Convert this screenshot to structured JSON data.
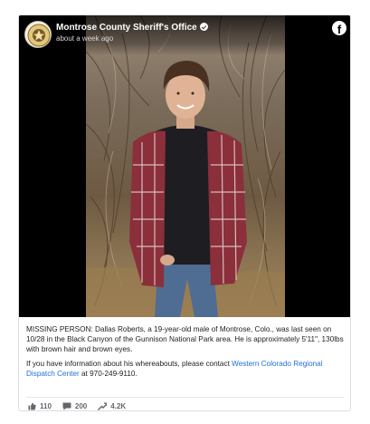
{
  "post": {
    "page_name": "Montrose County Sheriff's Office",
    "timestamp": "about a week ago",
    "brand_icon": "facebook-icon",
    "body": {
      "paragraph_1": "MISSING PERSON: Dallas Roberts, a 19-year-old male of Montrose, Colo., was last seen on 10/28 in the Black Canyon of the Gunnison National Park area. He is approximately 5'11\", 130lbs with brown hair and brown eyes.",
      "paragraph_2_before_link": "If you have information about his whereabouts, please contact ",
      "paragraph_2_link": "Western Colorado Regional Dispatch Center",
      "paragraph_2_after_link": " at 970-249-9110."
    }
  },
  "stats": {
    "likes": "110",
    "comments": "200",
    "shares": "4.2K"
  },
  "colors": {
    "link": "#216fdb",
    "muted": "#65676b",
    "text": "#1c1e21"
  }
}
